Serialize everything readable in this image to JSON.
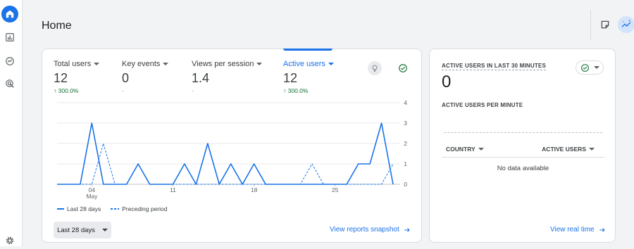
{
  "page": {
    "title": "Home"
  },
  "sidebar": {
    "items": [
      {
        "name": "home",
        "icon": "home-icon",
        "active": true
      },
      {
        "name": "reports",
        "icon": "bar-chart-icon",
        "active": false
      },
      {
        "name": "explore",
        "icon": "explore-icon",
        "active": false
      },
      {
        "name": "advertising",
        "icon": "target-icon",
        "active": false
      }
    ],
    "settings_icon": "gear-icon"
  },
  "top_actions": {
    "icons": [
      "notes-icon",
      "insights-icon"
    ]
  },
  "metrics": [
    {
      "label": "Total users",
      "value": "12",
      "change": "↑ 300.0%",
      "active": false
    },
    {
      "label": "Key events",
      "value": "0",
      "change": "-",
      "active": false
    },
    {
      "label": "Views per session",
      "value": "1.4",
      "change": "-",
      "active": false
    },
    {
      "label": "Active users",
      "value": "12",
      "change": "↑ 300.0%",
      "active": true
    }
  ],
  "chart_data": {
    "type": "line",
    "x_tick_labels": [
      "04\nMay",
      "11",
      "18",
      "25"
    ],
    "x_tick_index": [
      3,
      10,
      17,
      24
    ],
    "y_ticks": [
      0,
      1,
      2,
      3,
      4
    ],
    "ylim": [
      0,
      4
    ],
    "series": [
      {
        "name": "Last 28 days",
        "style": "solid",
        "color": "#1a73e8",
        "values": [
          0,
          0,
          0,
          3,
          0,
          0,
          0,
          1,
          0,
          0,
          0,
          1,
          0,
          2,
          0,
          1,
          0,
          1,
          0,
          0,
          0,
          0,
          0,
          0,
          0,
          0,
          1,
          1,
          3,
          0
        ]
      },
      {
        "name": "Preceding period",
        "style": "dashed",
        "color": "#1a73e8",
        "values": [
          0,
          0,
          0,
          0,
          2,
          0,
          0,
          1,
          0,
          0,
          0,
          0,
          0,
          0,
          0,
          0,
          0,
          0,
          0,
          0,
          0,
          0,
          1,
          0,
          0,
          0,
          0,
          0,
          0,
          1
        ]
      }
    ],
    "grid": true,
    "legend_position": "bottom-left"
  },
  "date_range": {
    "label": "Last 28 days"
  },
  "links": {
    "reports_snapshot": "View reports snapshot",
    "realtime": "View real time"
  },
  "realtime": {
    "title": "ACTIVE USERS IN LAST 30 MINUTES",
    "value": "0",
    "per_minute_label": "ACTIVE USERS PER MINUTE",
    "col_country": "COUNTRY",
    "col_active_users": "ACTIVE USERS",
    "empty_text": "No data available"
  },
  "colors": {
    "accent": "#1a73e8",
    "positive": "#137333",
    "background": "#f1f3f4"
  }
}
